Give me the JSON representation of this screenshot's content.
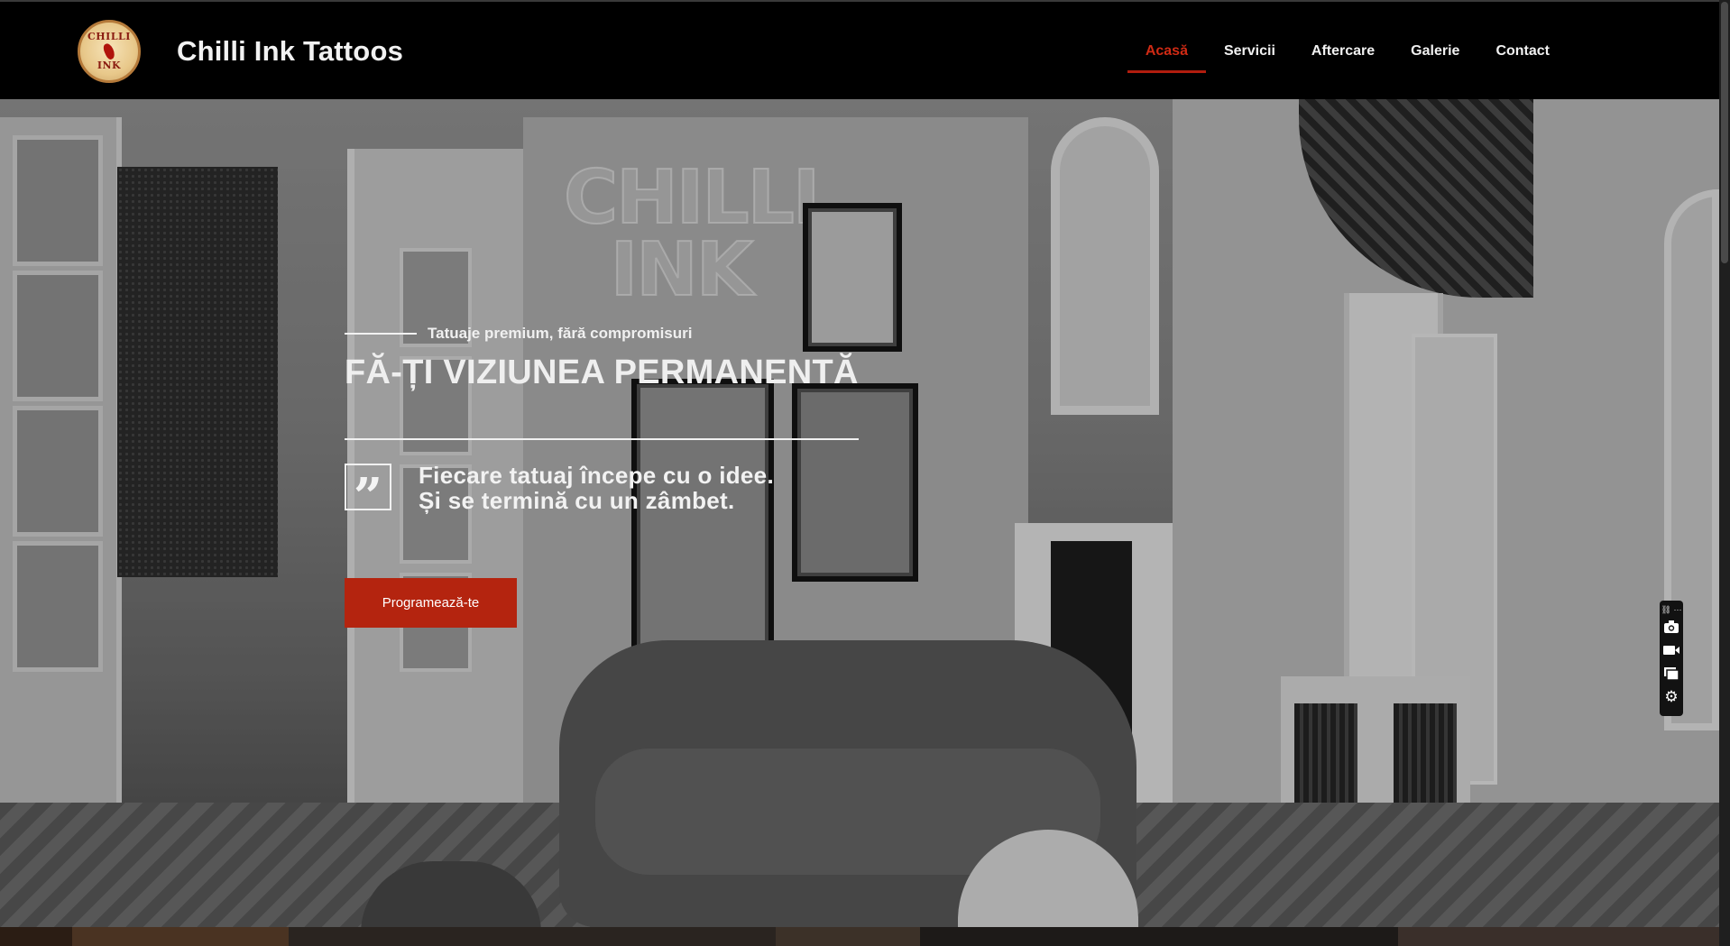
{
  "header": {
    "site_title": "Chilli Ink Tattoos",
    "logo": {
      "line1": "CHILLI",
      "line2": "INK"
    }
  },
  "nav": {
    "items": [
      {
        "label": "Acasă",
        "active": true
      },
      {
        "label": "Servicii",
        "active": false
      },
      {
        "label": "Aftercare",
        "active": false
      },
      {
        "label": "Galerie",
        "active": false
      },
      {
        "label": "Contact",
        "active": false
      }
    ]
  },
  "hero": {
    "eyebrow": "Tatuaje premium, fără compromisuri",
    "headline": "FĂ-ȚI VIZIUNEA PERMANENTĂ",
    "quote_line1": "Fiecare tatuaj începe cu o idee.",
    "quote_line2": "Și se termină cu un zâmbet.",
    "cta_label": "Programează-te",
    "neon_sign_line1": "CHILLI",
    "neon_sign_line2": "INK"
  },
  "floating_toolbar": {
    "tools": [
      "camera-icon",
      "video-icon",
      "screens-icon",
      "settings-icon"
    ]
  },
  "colors": {
    "accent": "#b4240f",
    "nav_active": "#cf2a14",
    "header_bg": "#000000"
  }
}
